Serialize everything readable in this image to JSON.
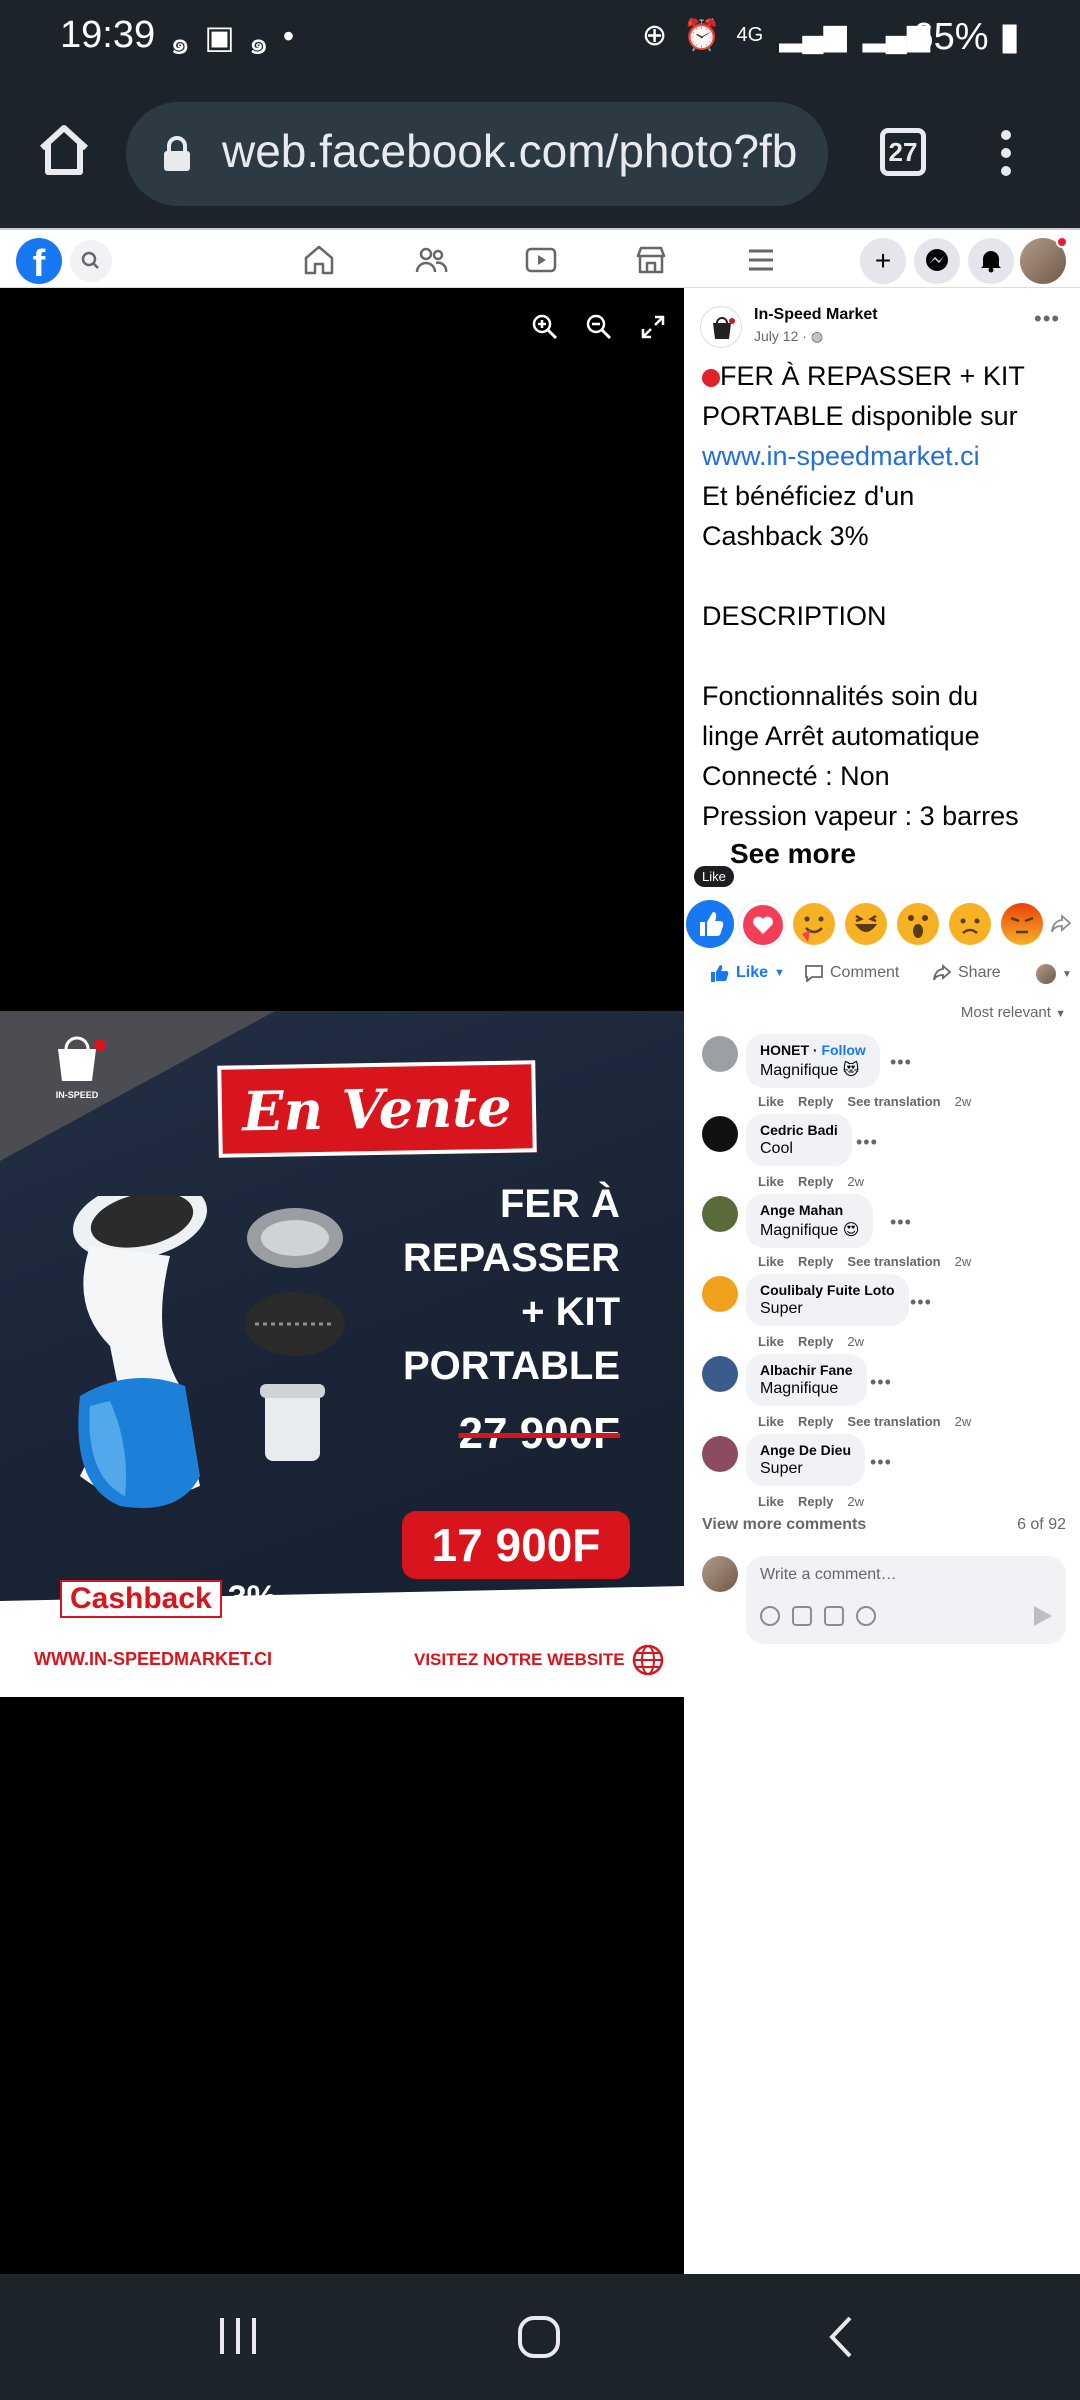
{
  "status_bar": {
    "time": "19:39",
    "network": "4G",
    "battery": "65%"
  },
  "browser": {
    "url": "web.facebook.com/photo?fb",
    "tab_count": "27"
  },
  "post": {
    "page_name": "In-Speed Market",
    "date": "July 12 · ",
    "text_lines": [
      "FER À REPASSER + KIT",
      "PORTABLE disponible sur"
    ],
    "link": "www.in-speedmarket.ci",
    "text_after": [
      "Et bénéficiez d'un",
      "Cashback 3%",
      "",
      "DESCRIPTION",
      "",
      "Fonctionnalités soin du",
      "linge Arrêt automatique",
      "Connecté : Non",
      "Pression vapeur : 3 barres"
    ],
    "see_more": "See more",
    "like_tooltip": "Like"
  },
  "actions": {
    "like": "Like",
    "comment": "Comment",
    "share": "Share",
    "sort": "Most relevant"
  },
  "comments": [
    {
      "name": "HONET",
      "follow": "Follow",
      "text": "Magnifique 😻",
      "translate": "See translation",
      "time": "2w",
      "avatar_color": "#9aa0a6"
    },
    {
      "name": "Cedric Badi",
      "follow": "",
      "text": "Cool",
      "translate": "",
      "time": "2w",
      "avatar_color": "#111111"
    },
    {
      "name": "Ange Mahan",
      "follow": "",
      "text": "Magnifique 😍",
      "translate": "See translation",
      "time": "2w",
      "avatar_color": "#5a6b3a"
    },
    {
      "name": "Coulibaly Fuite Loto",
      "follow": "",
      "text": "Super",
      "translate": "",
      "time": "2w",
      "avatar_color": "#f0a21c"
    },
    {
      "name": "Albachir Fane",
      "follow": "",
      "text": "Magnifique",
      "translate": "See translation",
      "time": "2w",
      "avatar_color": "#3b5b8c"
    },
    {
      "name": "Ange De Dieu",
      "follow": "",
      "text": "Super",
      "translate": "",
      "time": "2w",
      "avatar_color": "#8c4b5e"
    }
  ],
  "comment_ui": {
    "like": "Like",
    "reply": "Reply",
    "view_more": "View more comments",
    "count": "6 of 92",
    "placeholder": "Write a comment…"
  },
  "photo": {
    "headline": "En Vente",
    "product": [
      "FER À",
      "REPASSER",
      "+ KIT",
      "PORTABLE"
    ],
    "old_price": "27 900F",
    "new_price": "17 900F",
    "cashback_label": "Cashback",
    "cashback_value": "3%",
    "website": "WWW.IN-SPEEDMARKET.CI",
    "cta": "VISITEZ NOTRE WEBSITE",
    "logo_text": "IN-SPEED"
  },
  "colors": {
    "fb_blue": "#1877f2",
    "link_blue": "#216fdb",
    "promo_red": "#d8141c",
    "dark_bar": "#1d232a"
  }
}
